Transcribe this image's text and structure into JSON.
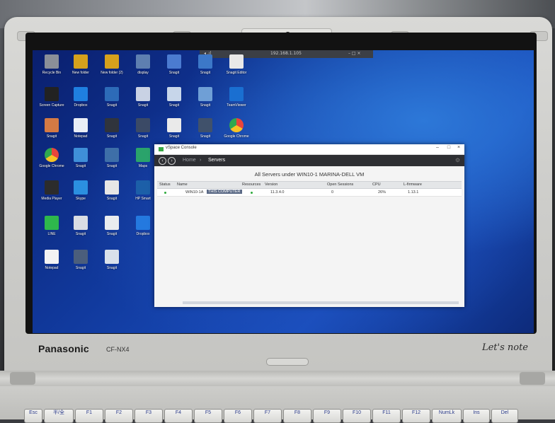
{
  "device": {
    "brand": "Panasonic",
    "model": "CF-NX4",
    "badge": "Let's note"
  },
  "top_strip": {
    "left": "◂ .ıl",
    "center": "192.168.1.105",
    "right": "– □ ×"
  },
  "desktop_icons": [
    {
      "label": "Recycle Bin",
      "color": "#8a8f98"
    },
    {
      "label": "New folder",
      "color": "#d6a11c"
    },
    {
      "label": "New folder (2)",
      "color": "#d6a11c"
    },
    {
      "label": "display",
      "color": "#5e7fb0"
    },
    {
      "label": "Snagit",
      "color": "#4b7bd0"
    },
    {
      "label": "Snagit",
      "color": "#3c78c8"
    },
    {
      "label": "Snagit Editor",
      "color": "#e8e8e8"
    },
    {
      "label": "Screen Capture",
      "color": "#222222"
    },
    {
      "label": "Dropbox",
      "color": "#1f7fe0"
    },
    {
      "label": "Snagit",
      "color": "#2d6bb8"
    },
    {
      "label": "Snagit",
      "color": "#c9d2e4"
    },
    {
      "label": "Snagit",
      "color": "#c7d6ea"
    },
    {
      "label": "Snagit",
      "color": "#6f9fd6"
    },
    {
      "label": "TeamViewer",
      "color": "#1a6fd1"
    },
    {
      "label": "Snagit",
      "color": "#d47a44"
    },
    {
      "label": "Notepad",
      "color": "#e9eef6"
    },
    {
      "label": "Snagit",
      "color": "#30343c"
    },
    {
      "label": "Snagit",
      "color": "#3b4a66"
    },
    {
      "label": "Snagit",
      "color": "#eaeaea"
    },
    {
      "label": "Snagit",
      "color": "#40516b"
    },
    {
      "label": "Google Chrome",
      "color": "#e8453c"
    },
    {
      "label": "Google Chrome",
      "color": "#e8453c"
    },
    {
      "label": "Snagit",
      "color": "#3f8fd8"
    },
    {
      "label": "Snagit",
      "color": "#3e6fa8"
    },
    {
      "label": "Maps",
      "color": "#2aa36b"
    },
    {
      "label": "Media Player",
      "color": "#2c2c2c"
    },
    {
      "label": "Skype",
      "color": "#2b8fe0"
    },
    {
      "label": "Snagit",
      "color": "#e6e6e6"
    },
    {
      "label": "HP Smart",
      "color": "#1c5fa8"
    },
    {
      "label": "LINE",
      "color": "#2eb84c"
    },
    {
      "label": "Snagit",
      "color": "#d9dde4"
    },
    {
      "label": "Snagit",
      "color": "#e9ecef"
    },
    {
      "label": "Dropbox",
      "color": "#2479df"
    },
    {
      "label": "Notepad",
      "color": "#f3f3f3"
    },
    {
      "label": "Snagit",
      "color": "#4b5e7c"
    },
    {
      "label": "Snagit",
      "color": "#d9e1eb"
    }
  ],
  "window": {
    "title": "vSpace Console",
    "nav": {
      "home": "Home",
      "sep": "›",
      "current": "Servers",
      "back": "‹",
      "forward": "›"
    },
    "heading": "All Servers under WIN10-1 MARINA-DELL VM",
    "columns": [
      "Status",
      "Name",
      "Resources",
      "Version",
      "Open Sessions",
      "CPU",
      "L-firmware"
    ],
    "row": {
      "name": "WIN10-1A",
      "tag": "THIS COMPUTER",
      "version": "11.3.4.0",
      "sessions": "0",
      "cpu": "26%",
      "firmware": "1.13.1"
    },
    "controls": {
      "minimize": "–",
      "maximize": "□",
      "close": "×"
    }
  },
  "keys": [
    "Esc",
    "半/全",
    "F1",
    "F2",
    "F3",
    "F4",
    "F5",
    "F6",
    "F7",
    "F8",
    "F9",
    "F10",
    "F11",
    "F12",
    "NumLk",
    "Ins",
    "Del"
  ]
}
